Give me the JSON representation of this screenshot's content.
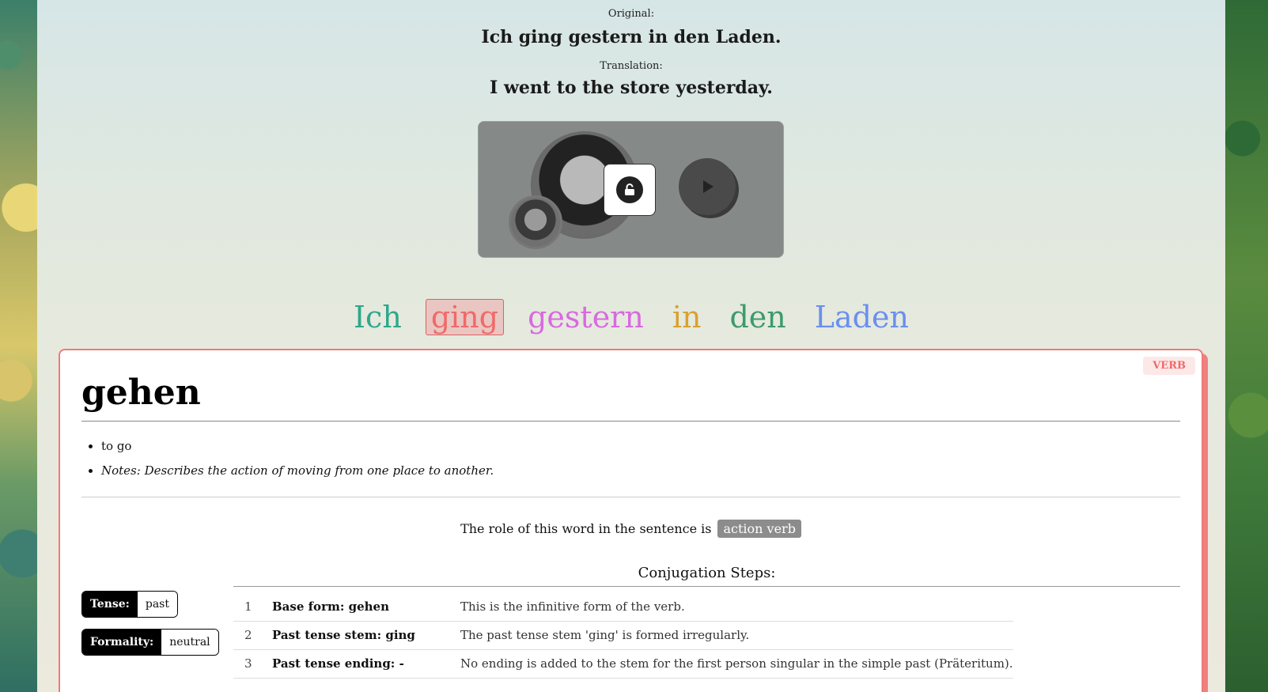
{
  "header": {
    "original_label": "Original:",
    "original_sentence": "Ich ging gestern in den Laden.",
    "translation_label": "Translation:",
    "translation_sentence": "I went to the store yesterday."
  },
  "media": {
    "lock_icon": "unlock-icon",
    "play_icon": "play-icon"
  },
  "words": [
    {
      "text": "Ich",
      "color": "#2fa88a"
    },
    {
      "text": "ging",
      "color": "#ef6a6a",
      "selected": true
    },
    {
      "text": "gestern",
      "color": "#d86adf"
    },
    {
      "text": "in",
      "color": "#d9a132"
    },
    {
      "text": "den",
      "color": "#3d9a6a"
    },
    {
      "text": "Laden",
      "color": "#6a8fef"
    }
  ],
  "card": {
    "pos_badge": "VERB",
    "lemma": "gehen",
    "definitions": [
      "to go"
    ],
    "notes": "Notes: Describes the action of moving from one place to another.",
    "role_text": "The role of this word in the sentence is",
    "role_value": "action verb",
    "tags": [
      {
        "key": "Tense:",
        "value": "past"
      },
      {
        "key": "Formality:",
        "value": "neutral"
      }
    ],
    "conjugation_title": "Conjugation Steps:",
    "conjugation_steps": [
      {
        "n": "1",
        "step": "Base form: gehen",
        "desc": "This is the infinitive form of the verb."
      },
      {
        "n": "2",
        "step": "Past tense stem: ging",
        "desc": "The past tense stem 'ging' is formed irregularly."
      },
      {
        "n": "3",
        "step": "Past tense ending: -",
        "desc": "No ending is added to the stem for the first person singular in the simple past (Präteritum)."
      }
    ]
  }
}
